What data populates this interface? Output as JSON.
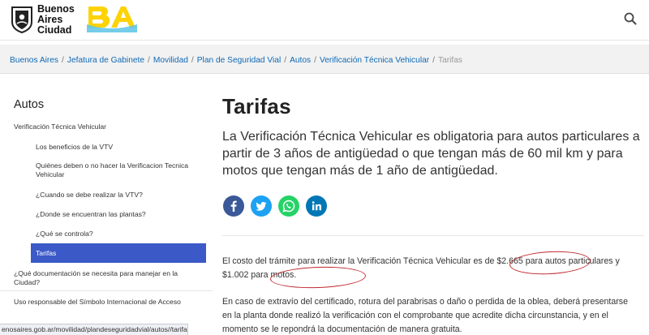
{
  "header": {
    "brand_line1": "Buenos",
    "brand_line2": "Aires",
    "brand_line3": "Ciudad",
    "logo_text": "BA",
    "search_icon": "search-icon"
  },
  "breadcrumb": {
    "items": [
      "Buenos Aires",
      "Jefatura de Gabinete",
      "Movilidad",
      "Plan de Seguridad Vial",
      "Autos",
      "Verificación Técnica Vehicular"
    ],
    "current": "Tarifas",
    "separator": "/"
  },
  "sidebar": {
    "title": "Autos",
    "section": "Verificación Técnica Vehicular",
    "items": [
      "Los beneficios de la VTV",
      "Quiénes deben o no hacer la Verificacion Tecnica Vehicular",
      "¿Cuando se debe realizar la VTV?",
      "¿Donde se encuentran las plantas?",
      "¿Qué se controla?"
    ],
    "active": "Tarifas",
    "after": [
      "¿Qué documentación se necesita para manejar en la Ciudad?",
      "Uso responsable del Símbolo Internacional de Acceso"
    ]
  },
  "main": {
    "title": "Tarifas",
    "lead": "La Verificación Técnica Vehicular es obligatoria para autos particulares a partir de 3 años de antigüedad o que tengan más de 60 mil km y para motos que tengan más de 1 año de antigüedad.",
    "share": [
      {
        "name": "facebook-icon",
        "glyph": "f",
        "color": "#3b5998"
      },
      {
        "name": "twitter-icon",
        "glyph": "t",
        "color": "#1da1f2"
      },
      {
        "name": "whatsapp-icon",
        "glyph": "w",
        "color": "#25d366"
      },
      {
        "name": "linkedin-icon",
        "glyph": "in",
        "color": "#0077b5"
      }
    ],
    "para1_a": "El costo del trámite para realizar la Verificación Técnica Vehicular es de ",
    "price_autos": "$2.665 para autos",
    "para1_b": " particulares y ",
    "price_motos": "$1.002 para motos.",
    "para2": "En caso de extravío del certificado, rotura del parabrisas o daño o perdida de la oblea, deberá presentarse en la planta donde realizó la verificación con el comprobante que acredite dicha circunstancia, y en el momento se le repondrá la documentación de manera gratuita."
  },
  "status": {
    "url": "enosaires.gob.ar/movilidad/plandeseguridadvial/autos//tarifas#"
  },
  "colors": {
    "link": "#0f69b4",
    "active_bg": "#3b5ac8",
    "annotation": "#c0272d",
    "ba_yellow": "#fdd306",
    "ba_cyan": "#5bc4e8"
  }
}
